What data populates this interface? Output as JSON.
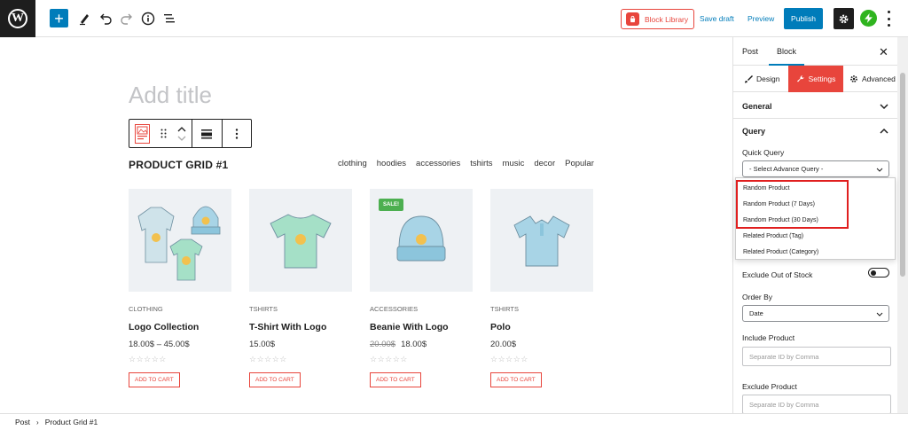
{
  "toolbar": {
    "block_library_label": "Block Library",
    "save_draft_label": "Save draft",
    "preview_label": "Preview",
    "publish_label": "Publish"
  },
  "editor": {
    "title_placeholder": "Add title",
    "grid_title": "PRODUCT GRID #1",
    "filters": [
      "clothing",
      "hoodies",
      "accessories",
      "tshirts",
      "music",
      "decor",
      "Popular"
    ],
    "products": [
      {
        "category": "CLOTHING",
        "name": "Logo Collection",
        "price": "18.00$ – 45.00$",
        "old_price": "",
        "sale": "",
        "cart": "ADD TO CART",
        "stars": "☆☆☆☆☆"
      },
      {
        "category": "TSHIRTS",
        "name": "T-Shirt With Logo",
        "price": "15.00$",
        "old_price": "",
        "sale": "",
        "cart": "ADD TO CART",
        "stars": "☆☆☆☆☆"
      },
      {
        "category": "ACCESSORIES",
        "name": "Beanie With Logo",
        "price": "18.00$",
        "old_price": "20.00$",
        "sale": "SALE!",
        "cart": "ADD TO CART",
        "stars": "☆☆☆☆☆"
      },
      {
        "category": "TSHIRTS",
        "name": "Polo",
        "price": "20.00$",
        "old_price": "",
        "sale": "",
        "cart": "ADD TO CART",
        "stars": "☆☆☆☆☆"
      }
    ]
  },
  "breadcrumb": {
    "root": "Post",
    "current": "Product Grid #1"
  },
  "sidebar": {
    "tab_post": "Post",
    "tab_block": "Block",
    "close": "✕",
    "sub_design": "Design",
    "sub_settings": "Settings",
    "sub_advanced": "Advanced",
    "general": "General",
    "query": "Query",
    "quick_query_label": "Quick Query",
    "quick_query_value": "- Select Advance Query -",
    "quick_query_options": [
      "Random Product",
      "Random Product (7 Days)",
      "Random Product (30 Days)",
      "Related Product (Tag)",
      "Related Product (Category)"
    ],
    "exclude_stock_label": "Exclude Out of Stock",
    "order_by_label": "Order By",
    "order_by_value": "Date",
    "include_label": "Include Product",
    "include_placeholder": "Separate ID by Comma",
    "exclude_label": "Exclude Product",
    "exclude_placeholder": "Separate ID by Comma"
  },
  "colors": {
    "accent": "#007cba",
    "brand_red": "#e8453c",
    "sale_green": "#4caf50",
    "highlight": "#e01f1f"
  }
}
